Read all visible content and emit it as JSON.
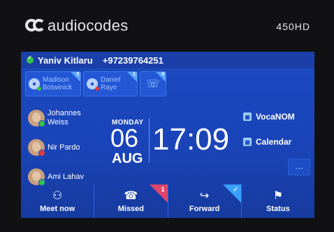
{
  "device": {
    "brand": "audiocodes",
    "model": "450HD"
  },
  "user": {
    "name": "Yaniv Kitlaru",
    "number": "+97239764251",
    "presence_color": "#35c24a"
  },
  "favorites": [
    {
      "line1": "Madison",
      "line2": "Botwinick",
      "count": "3",
      "status_color": "#35c24a"
    },
    {
      "line1": "Daniel",
      "line2": "Raye",
      "count": "1",
      "status_color": "#e03b3b"
    },
    {
      "line1": "",
      "line2": "",
      "count": "4",
      "icon": "phone-icon"
    }
  ],
  "contacts": [
    {
      "line1": "Johannes",
      "line2": "Weiss",
      "status_color": "#35c24a"
    },
    {
      "line1": "Nir Pardo",
      "line2": "",
      "status_color": "#e03b3b"
    },
    {
      "line1": "Ami Lahav",
      "line2": "",
      "status_color": "#35c24a"
    }
  ],
  "clock": {
    "weekday": "MONDAY",
    "day": "06",
    "month": "AUG",
    "time": "17:09"
  },
  "side_buttons": [
    {
      "label": "VocaNOM",
      "icon": "voicemail-icon"
    },
    {
      "label": "Calendar",
      "icon": "calendar-icon"
    }
  ],
  "more_label": "...",
  "softkeys": [
    {
      "label": "Meet now",
      "icon": "meet-now-icon",
      "badge": ""
    },
    {
      "label": "Missed",
      "icon": "missed-calls-icon",
      "badge": "1",
      "badge_color": "#e0466c"
    },
    {
      "label": "Forward",
      "icon": "forward-icon",
      "badge": "✓",
      "badge_color": "#39a0ff"
    },
    {
      "label": "Status",
      "icon": "flag-icon",
      "badge": ""
    }
  ]
}
